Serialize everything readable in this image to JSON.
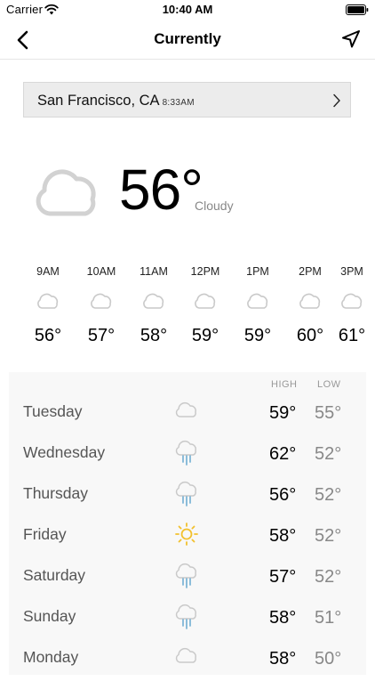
{
  "status_bar": {
    "carrier": "Carrier",
    "time": "10:40 AM"
  },
  "nav": {
    "title": "Currently",
    "back_icon": "chevron-left-icon",
    "location_icon": "location-arrow-icon"
  },
  "location": {
    "name": "San Francisco, CA",
    "time": "8:33AM"
  },
  "current": {
    "temperature": "56°",
    "condition": "Cloudy",
    "icon": "cloud-icon"
  },
  "hourly": [
    {
      "time": "9AM",
      "temp": "56°",
      "icon": "cloud-icon"
    },
    {
      "time": "10AM",
      "temp": "57°",
      "icon": "cloud-icon"
    },
    {
      "time": "11AM",
      "temp": "58°",
      "icon": "cloud-icon"
    },
    {
      "time": "12PM",
      "temp": "59°",
      "icon": "cloud-icon"
    },
    {
      "time": "1PM",
      "temp": "59°",
      "icon": "cloud-icon"
    },
    {
      "time": "2PM",
      "temp": "60°",
      "icon": "cloud-icon"
    },
    {
      "time": "3PM",
      "temp": "61°",
      "icon": "cloud-icon"
    }
  ],
  "daily": {
    "header_high": "HIGH",
    "header_low": "LOW",
    "days": [
      {
        "day": "Tuesday",
        "high": "59°",
        "low": "55°",
        "icon": "cloud-icon"
      },
      {
        "day": "Wednesday",
        "high": "62°",
        "low": "52°",
        "icon": "rain-icon"
      },
      {
        "day": "Thursday",
        "high": "56°",
        "low": "52°",
        "icon": "rain-icon"
      },
      {
        "day": "Friday",
        "high": "58°",
        "low": "52°",
        "icon": "sun-icon"
      },
      {
        "day": "Saturday",
        "high": "57°",
        "low": "52°",
        "icon": "rain-icon"
      },
      {
        "day": "Sunday",
        "high": "58°",
        "low": "51°",
        "icon": "rain-icon"
      },
      {
        "day": "Monday",
        "high": "58°",
        "low": "50°",
        "icon": "cloud-icon"
      }
    ]
  },
  "colors": {
    "cloud_stroke": "#d2d2d2",
    "rain_drops": "#7fb6d6",
    "sun": "#f2c12e"
  }
}
